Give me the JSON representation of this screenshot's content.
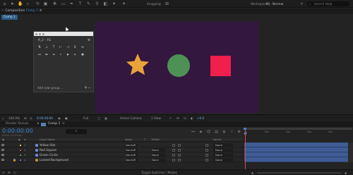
{
  "topbar": {
    "snapping_label": "Snapping",
    "workspace_label": "Workspace:",
    "workspace_value": "MJ - Normal",
    "search_placeholder": "Search Help"
  },
  "composition_tab": {
    "prefix": "Composition",
    "name": "Comp 1",
    "close": "×"
  },
  "viewer_subtab": "Comp 1",
  "canvas": {
    "background": "#33173f",
    "shapes": [
      {
        "name": "star",
        "color": "#e8a33a"
      },
      {
        "name": "circle",
        "color": "#4e9154"
      },
      {
        "name": "square",
        "color": "#f01f4b"
      }
    ]
  },
  "floating_panel": {
    "title": "ft_2 – FG",
    "add_group": "Add new group ...",
    "add": "+",
    "remove": "–"
  },
  "viewer_bar": {
    "zoom": "100.0%",
    "timecode": "0:00:00:00",
    "resolution": "Full",
    "camera": "Active Camera",
    "views": "1 View",
    "exposure": "+0.0"
  },
  "timeline": {
    "tabs": [
      {
        "label": "Render Queue",
        "active": false
      },
      {
        "label": "Comp 1",
        "active": true
      }
    ],
    "current_time": "0:00:00:00",
    "current_time_sub": "00000 (30.00 fps)",
    "ruler_ticks": [
      "0s",
      "01s",
      "02s",
      "03s",
      "04s"
    ],
    "columns": {
      "layer_name": "Layer Name",
      "mode": "Mode",
      "trkmat": "TrkMat",
      "parent": "Parent"
    },
    "layers": [
      {
        "num": "1",
        "name": "Yellow Star",
        "mode": "Normal",
        "trkmat": "",
        "parent": "None",
        "label_color": "#e8c94a",
        "icon_color": "#6a86d8"
      },
      {
        "num": "2",
        "name": "Red Square",
        "mode": "Normal",
        "trkmat": "None",
        "parent": "None",
        "label_color": "#d14a4a",
        "icon_color": "#6a86d8"
      },
      {
        "num": "3",
        "name": "Green Circle",
        "mode": "Normal",
        "trkmat": "None",
        "parent": "None",
        "label_color": "#4aa35a",
        "icon_color": "#6a86d8"
      },
      {
        "num": "4",
        "name": "Locked Background",
        "mode": "Normal",
        "trkmat": "None",
        "parent": "None",
        "label_color": "#8a6ad0",
        "icon_color": "#b48a4a"
      }
    ]
  },
  "footer": {
    "toggle_label": "Toggle Switches / Modes"
  },
  "colors": {
    "accent_blue": "#3d86d6",
    "layer_bar": "#3f5c95",
    "playhead": "#d24545"
  }
}
